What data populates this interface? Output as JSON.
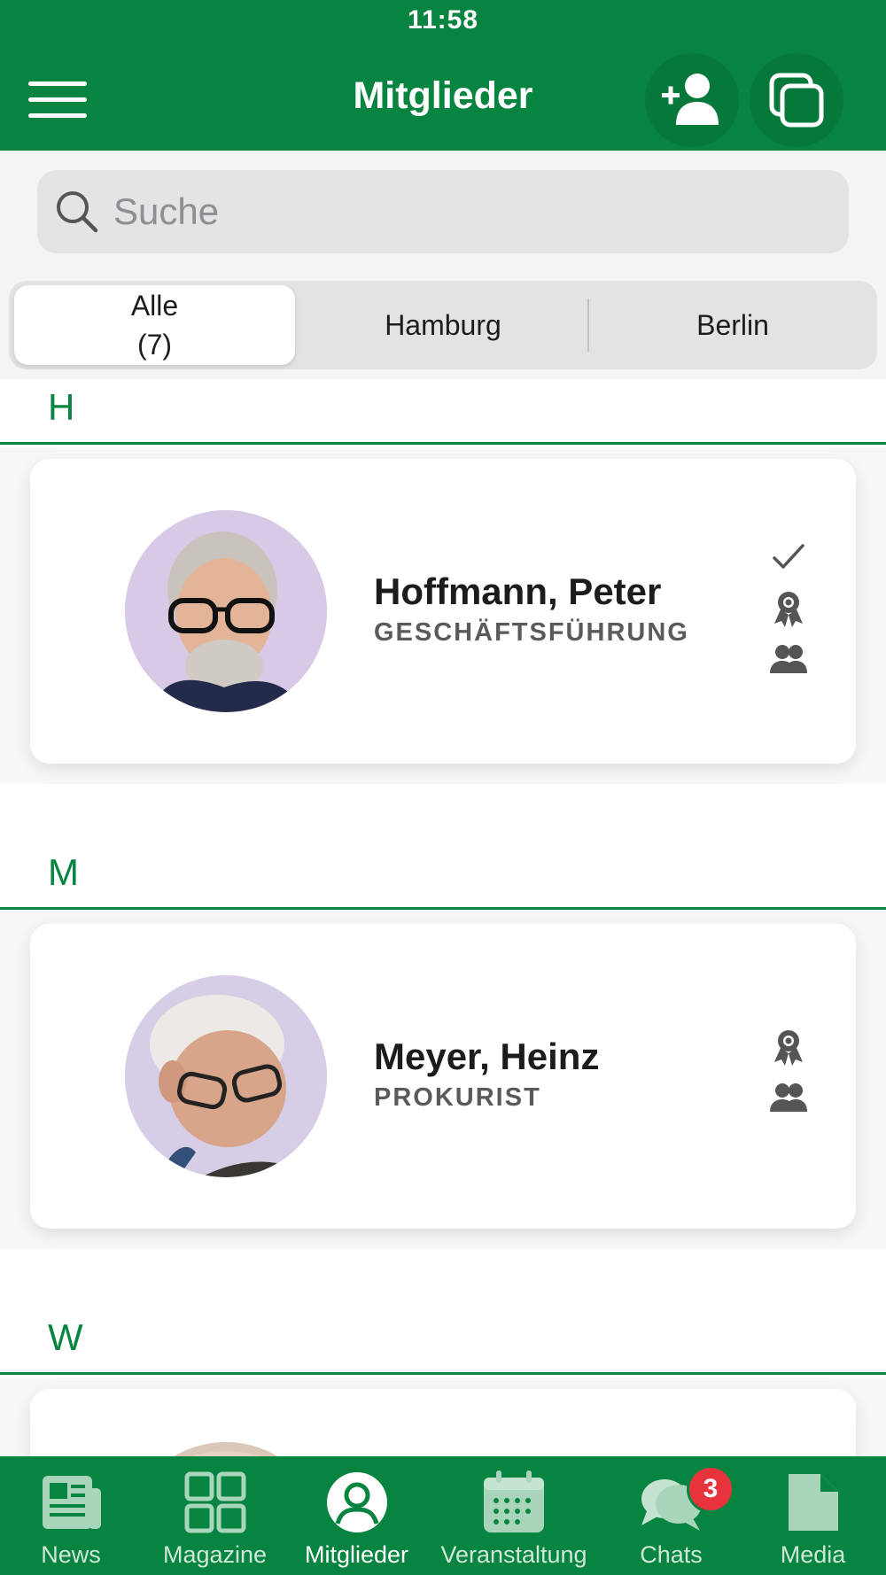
{
  "status_bar": {
    "time": "11:58"
  },
  "header": {
    "title": "Mitglieder",
    "menu_icon": "hamburger-menu-icon",
    "add_member_icon": "add-person-icon",
    "copy_icon": "copy-icon"
  },
  "search": {
    "placeholder": "Suche"
  },
  "segments": {
    "items": [
      {
        "label": "Alle",
        "count": "(7)",
        "selected": true
      },
      {
        "label": "Hamburg",
        "selected": false
      },
      {
        "label": "Berlin",
        "selected": false
      }
    ]
  },
  "sections": [
    {
      "letter": "H",
      "members": [
        {
          "name": "Hoffmann, Peter",
          "role": "GESCHÄFTSFÜHRUNG",
          "icons": [
            "checkmark-icon",
            "award-icon",
            "group-icon"
          ]
        }
      ]
    },
    {
      "letter": "M",
      "members": [
        {
          "name": "Meyer, Heinz",
          "role": "PROKURIST",
          "icons": [
            "award-icon",
            "group-icon"
          ]
        }
      ]
    },
    {
      "letter": "W",
      "members": []
    }
  ],
  "tabbar": {
    "tabs": [
      {
        "label": "News",
        "icon": "newspaper-icon",
        "active": false
      },
      {
        "label": "Magazine",
        "icon": "grid-icon",
        "active": false
      },
      {
        "label": "Mitglieder",
        "icon": "person-circle-icon",
        "active": true
      },
      {
        "label": "Veranstaltung",
        "icon": "calendar-icon",
        "active": false
      },
      {
        "label": "Chats",
        "icon": "chat-bubbles-icon",
        "active": false,
        "badge": "3"
      },
      {
        "label": "Media",
        "icon": "document-icon",
        "active": false
      }
    ]
  },
  "colors": {
    "brand_green": "#07843f",
    "badge_red": "#e8333d"
  }
}
